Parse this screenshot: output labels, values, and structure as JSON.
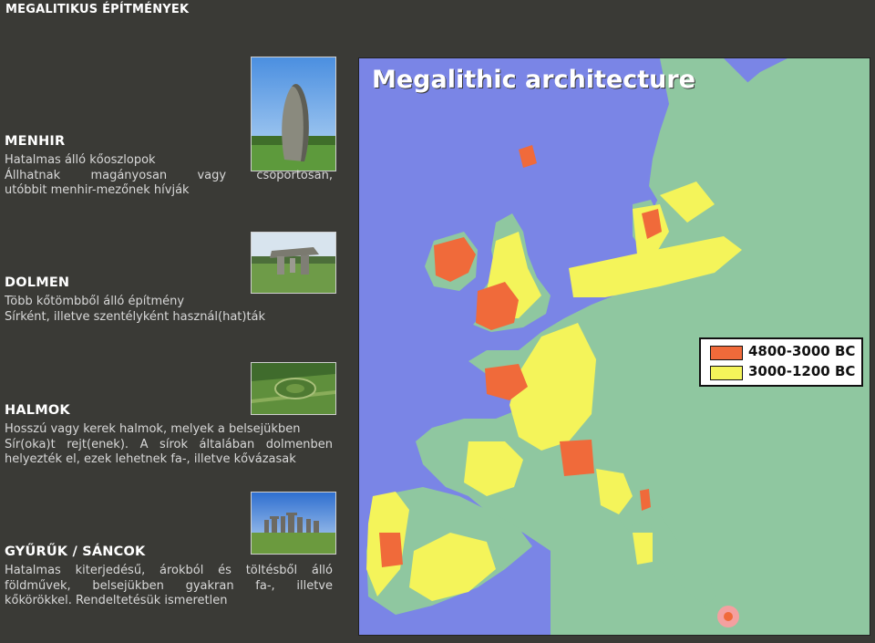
{
  "page": {
    "title": "MEGALITIKUS ÉPÍTMÉNYEK"
  },
  "sections": [
    {
      "heading": "MENHIR",
      "lines": [
        "Hatalmas álló kőoszlopok",
        "Állhatnak magányosan vagy csoportosan,",
        "utóbbit menhir-mezőnek hívják"
      ]
    },
    {
      "heading": "DOLMEN",
      "lines": [
        "Több kőtömbből álló építmény",
        "Sírként, illetve szentélyként használ(hat)ták"
      ]
    },
    {
      "heading": "HALMOK",
      "lines": [
        "Hosszú vagy kerek halmok, melyek a belsejükben",
        "Sír(oka)t rejt(enek). A sírok általában dolmenben",
        "helyezték el, ezek lehetnek fa-, illetve kővázasak"
      ]
    },
    {
      "heading": "GYŰRŰK / SÁNCOK",
      "lines": [
        "Hatalmas kiterjedésű, árokból és töltésből álló",
        "földművek, belsejükben gyakran fa-, illetve",
        "kőkörökkel. Rendeltetésük ismeretlen"
      ]
    }
  ],
  "map": {
    "title": "Megalithic architecture",
    "legend": [
      {
        "label": "4800-3000 BC",
        "color": "#f06a3a"
      },
      {
        "label": "3000-1200 BC",
        "color": "#f4f45a"
      }
    ],
    "colors": {
      "sea": "#7a85e6",
      "land": "#8fc7a0",
      "early": "#f06a3a",
      "late": "#f4f45a"
    }
  }
}
